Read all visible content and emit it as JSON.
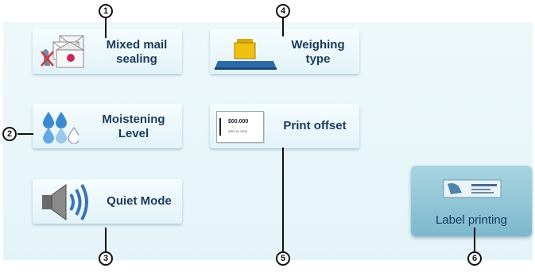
{
  "tiles": {
    "mixed_mail": {
      "line1": "Mixed mail",
      "line2": "sealing"
    },
    "moistening": {
      "line1": "Moistening",
      "line2": "Level"
    },
    "quiet": {
      "label": "Quiet Mode"
    },
    "weighing": {
      "line1": "Weighing",
      "line2": "type"
    },
    "print_offset": {
      "label": "Print offset",
      "card_amount": "$00.000",
      "card_date": "APR 16 1993"
    }
  },
  "label_printing": {
    "label": "Label printing"
  },
  "callouts": [
    "1",
    "2",
    "3",
    "4",
    "5",
    "6"
  ],
  "icons": {
    "mixed_mail": "envelopes-no-seal-icon",
    "moistening": "water-drops-icon",
    "quiet": "speaker-icon",
    "weighing": "scale-weight-icon",
    "print_offset": "postage-imprint-icon",
    "label_printing": "label-tape-icon"
  },
  "colors": {
    "tile_text": "#1a3a5a",
    "label_button": "#8cc3d4"
  }
}
